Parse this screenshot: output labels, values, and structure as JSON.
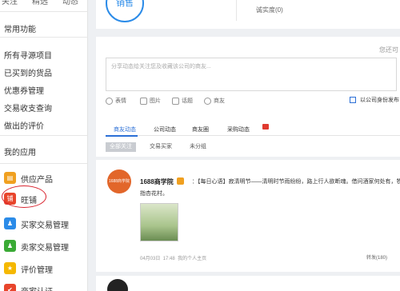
{
  "sidebar": {
    "top_tabs": [
      "关注",
      "精选",
      "动态"
    ],
    "common_title": "常用功能",
    "links": [
      "所有寻源项目",
      "已买到的货品",
      "优惠券管理",
      "交易收支查询",
      "做出的评价"
    ],
    "my_apps_title": "我的应用",
    "apps": [
      {
        "label": "供应产品",
        "icon": "box-icon",
        "color": "#f0a020",
        "glyph": "▤"
      },
      {
        "label": "旺铺",
        "icon": "shop-icon",
        "color": "#e8452c",
        "glyph": "铺"
      },
      {
        "label": "买家交易管理",
        "icon": "buyer-icon",
        "color": "#2b8be8",
        "glyph": "♟"
      },
      {
        "label": "卖家交易管理",
        "icon": "seller-icon",
        "color": "#3aaa35",
        "glyph": "♟"
      },
      {
        "label": "评价管理",
        "icon": "star-icon",
        "color": "#f5b800",
        "glyph": "★"
      },
      {
        "label": "商家认证",
        "icon": "cert-icon",
        "color": "#e8452c",
        "glyph": "✔"
      }
    ]
  },
  "profile": {
    "sell_label": "销售",
    "credit_label": "诚实度(0)"
  },
  "compose": {
    "placeholder": "分享动态给关注您及收藏该公司的商友...",
    "visit_link": "您还可",
    "tools": [
      "表情",
      "图片",
      "话题",
      "商友"
    ],
    "share_as_company": "以公司身份发布"
  },
  "feed_tabs": {
    "tabs": [
      "商友动态",
      "公司动态",
      "商友圈",
      "采购动态"
    ],
    "chips": [
      "全部关注",
      "交易买家",
      "未分组"
    ]
  },
  "post": {
    "author": "1688商学院",
    "text": "：【每日心语】寂清明节——清明时节雨纷纷，路上行人欲断魂。借问酒家何处有，牧童遥",
    "text_line2": "指杏花村。",
    "avatar_text": "1688商学院",
    "date": "04月03日",
    "time": "17:48",
    "source": "我的个人主页",
    "reply": "转发(180)"
  },
  "colors": {
    "accent": "#2b6fd6",
    "circle": "#d9232e"
  }
}
